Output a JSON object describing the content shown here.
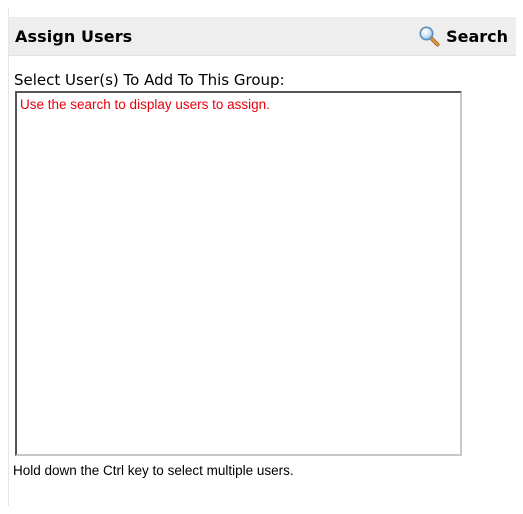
{
  "header": {
    "title": "Assign Users",
    "search_label": "Search",
    "search_icon": "search-icon"
  },
  "form": {
    "select_label": "Select User(s) To Add To This Group:",
    "list_message": "Use the search to display users to assign.",
    "help_text": "Hold down the Ctrl key to select multiple users."
  },
  "colors": {
    "header_bg": "#eeeeee",
    "message_text": "#e8000d"
  }
}
